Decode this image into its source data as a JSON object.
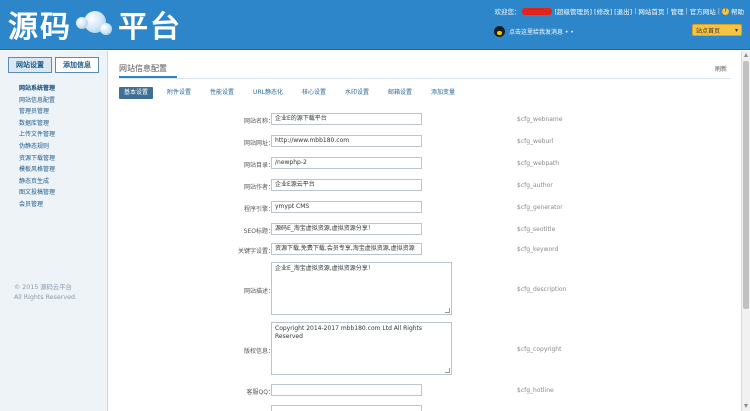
{
  "header": {
    "logo_left": "源码",
    "logo_right": "平台",
    "welcome": "欢迎您：",
    "user_suffix": "[超级管理员]",
    "links": [
      "[修改]",
      "[退出]",
      "网站首页",
      "管理",
      "帮助",
      "官方网站"
    ],
    "qq_text": "点击这里给我发消息 • •",
    "site_select": "站点首页",
    "brand_color": "#2d86c9"
  },
  "sidebar": {
    "tabs": [
      "网站设置",
      "添加信息"
    ],
    "items": [
      "网站系统管理",
      "网站信息配置",
      "管理员管理",
      "数据库管理",
      "上传文件管理",
      "伪静态规则",
      "资源下载管理",
      "模板风格管理",
      "静态页生成",
      "图文投稿管理",
      "会员管理"
    ],
    "copyright_line1": "© 2015 源码云平台",
    "copyright_line2": "All Rights Reserved."
  },
  "main": {
    "title": "网站信息配置",
    "back": "刷新",
    "tabs": [
      "基本设置",
      "附件设置",
      "性能设置",
      "URL静态化",
      "核心设置",
      "水印设置",
      "邮箱设置",
      "添加变量"
    ],
    "fields": [
      {
        "label": "网站名称：",
        "value": "企业E的源下载平台",
        "var": "$cfg_webname"
      },
      {
        "label": "网站网址：",
        "value": "http://www.mbb180.com",
        "var": "$cfg_weburl"
      },
      {
        "label": "网站目录：",
        "value": "/newphp-2",
        "var": "$cfg_webpath"
      },
      {
        "label": "网站作者：",
        "value": "企业E源云平台",
        "var": "$cfg_author"
      },
      {
        "label": "程序引擎：",
        "value": "ymypt CMS",
        "var": "$cfg_generator"
      },
      {
        "label": "SEO标题：",
        "value": "源码E_淘宝虚拟资源,虚拟资源分享！",
        "var": "$cfg_seotitle"
      },
      {
        "label": "关键字设置：",
        "value": "资源下载,免费下载,会员专享,淘宝虚拟资源,虚拟资源",
        "var": "$cfg_keyword"
      },
      {
        "label": "网站描述：",
        "value": "企业E_淘宝虚拟资源,虚拟资源分享！",
        "var": "$cfg_description"
      },
      {
        "label": "版权信息：",
        "value": "Copyright 2014-2017 mbb180.com Ltd All Rights Reserved",
        "var": "$cfg_copyright"
      },
      {
        "label": "客服QQ：",
        "value": "",
        "var": "$cfg_hotline"
      },
      {
        "label": "",
        "value": "",
        "var": ""
      }
    ]
  },
  "ui": {
    "help_glyph": "?"
  }
}
